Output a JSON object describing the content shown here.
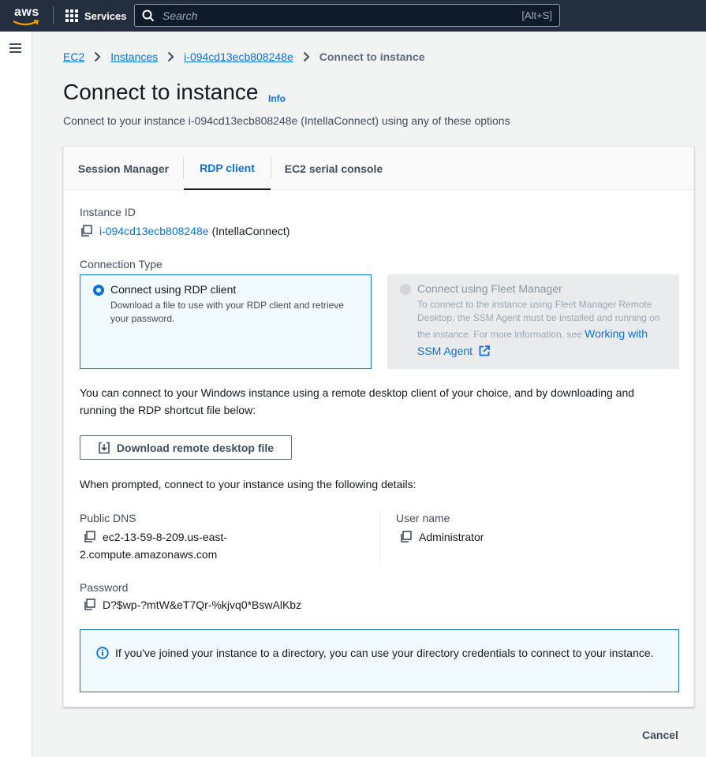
{
  "topnav": {
    "logo_text": "aws",
    "services_label": "Services",
    "search_placeholder": "Search",
    "search_shortcut": "[Alt+S]"
  },
  "breadcrumb": [
    "EC2",
    "Instances",
    "i-094cd13ecb808248e",
    "Connect to instance"
  ],
  "page": {
    "title": "Connect to instance",
    "info_label": "Info",
    "subtitle": "Connect to your instance i-094cd13ecb808248e (IntellaConnect) using any of these options"
  },
  "tabs": [
    "Session Manager",
    "RDP client",
    "EC2 serial console"
  ],
  "instance": {
    "label": "Instance ID",
    "id": "i-094cd13ecb808248e",
    "name": "(IntellaConnect)"
  },
  "connection_type": {
    "label": "Connection Type",
    "rdp": {
      "title": "Connect using RDP client",
      "desc": "Download a file to use with your RDP client and retrieve your password."
    },
    "fleet": {
      "title": "Connect using Fleet Manager",
      "desc": "To connect to the instance using Fleet Manager Remote Desktop, the SSM Agent must be installed and running on the instance. For more information, see",
      "link": "Working with SSM Agent"
    }
  },
  "rdp_intro": "You can connect to your Windows instance using a remote desktop client of your choice, and by downloading and running the RDP shortcut file below:",
  "download_button": "Download remote desktop file",
  "prompt_text": "When prompted, connect to your instance using the following details:",
  "details": {
    "public_dns_label": "Public DNS",
    "public_dns_line1": "ec2-13-59-8-209.us-east-",
    "public_dns_line2": "2.compute.amazonaws.com",
    "username_label": "User name",
    "username": "Administrator",
    "password_label": "Password",
    "password": "D?$wp-?mtW&eT7Qr-%kjvq0*BswAlKbz"
  },
  "alert": {
    "text": "If you've joined your instance to a directory, you can use your directory credentials to connect to your instance."
  },
  "footer": {
    "cancel_label": "Cancel"
  },
  "colors": {
    "nav_bg": "#232f3e",
    "link": "#0972d3",
    "selected_tile_bg": "#f1faff"
  }
}
